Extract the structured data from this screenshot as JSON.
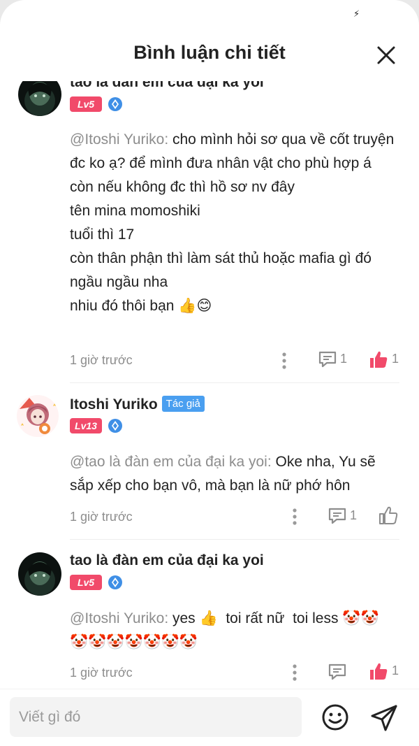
{
  "header": {
    "title": "Bình luận chi tiết"
  },
  "comments": [
    {
      "username": "tao là đàn em của đại ka yoi",
      "level": "Lv5",
      "mention": "@Itoshi Yuriko:",
      "body": " cho mình hỏi sơ qua về cốt truyện đc ko ạ? để mình đưa nhân vật cho phù hợp á\ncòn nếu không đc thì hồ sơ nv đây\ntên mina momoshiki\ntuổi thì 17\ncòn thân phận thì làm sát thủ hoặc mafia gì đó ngầu ngầu nha\nnhiu đó thôi bạn 👍😊",
      "time": "1 giờ trước",
      "reply_count": "1",
      "like_count": "1",
      "liked": true
    },
    {
      "username": "Itoshi Yuriko",
      "author_tag": "Tác giả",
      "level": "Lv13",
      "mention": "@tao là đàn em của đại ka yoi:",
      "body": " Oke nha, Yu sẽ sắp xếp cho bạn vô, mà bạn là nữ phớ hôn",
      "time": "1 giờ trước",
      "reply_count": "1",
      "like_count": "",
      "liked": false
    },
    {
      "username": "tao là đàn em của đại ka yoi",
      "level": "Lv5",
      "mention": "@Itoshi Yuriko:",
      "body": " yes 👍  toi rất nữ  toi less 🤡🤡\n🤡🤡🤡🤡🤡🤡🤡",
      "time": "1 giờ trước",
      "reply_count": "",
      "like_count": "1",
      "liked": true
    }
  ],
  "composer": {
    "placeholder": "Viết gì đó"
  },
  "colors": {
    "like_active": "#f14a6a",
    "level_badge": "#f14a6a",
    "author_tag": "#4a9ff0",
    "muted_text": "#8d8d8d"
  },
  "icons": [
    "close-icon",
    "more-vertical-icon",
    "comment-icon",
    "thumbs-up-icon",
    "emoji-icon",
    "send-icon",
    "gem-icon"
  ]
}
